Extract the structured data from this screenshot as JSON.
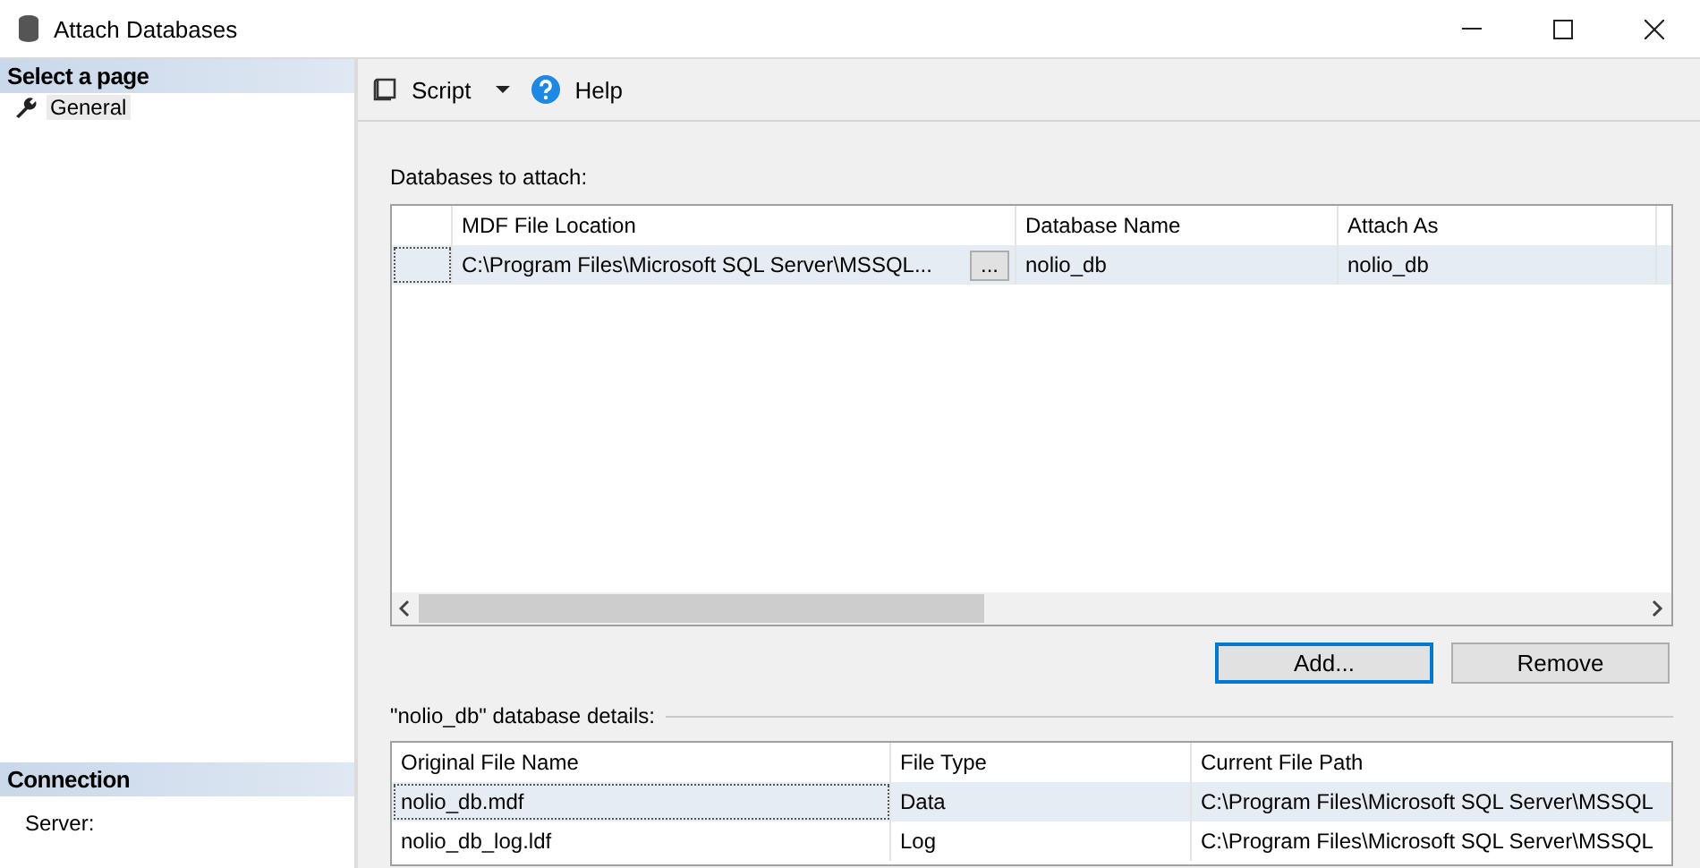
{
  "window": {
    "title": "Attach Databases"
  },
  "sidebar": {
    "header": "Select a page",
    "items": [
      {
        "label": "General",
        "selected": true
      }
    ],
    "connection_header": "Connection",
    "connection_items": [
      "Server:"
    ]
  },
  "toolbar": {
    "items": [
      {
        "label": "Script",
        "kind": "script"
      },
      {
        "label": "Help",
        "kind": "help"
      }
    ]
  },
  "attach": {
    "label": "Databases to attach:",
    "columns": [
      "MDF File Location",
      "Database Name",
      "Attach As"
    ],
    "rows": [
      {
        "cells": [
          "C:\\Program Files\\Microsoft SQL Server\\MSSQL...",
          "nolio_db",
          "nolio_db"
        ],
        "browse_button": "...",
        "selected": true
      }
    ]
  },
  "buttons": [
    {
      "label": "Add...",
      "focused": true
    },
    {
      "label": "Remove",
      "focused": false
    }
  ],
  "details": {
    "label": "\"nolio_db\" database details:",
    "columns": [
      "Original File Name",
      "File Type",
      "Current File Path"
    ],
    "rows": [
      {
        "cells": [
          "nolio_db.mdf",
          "Data",
          "C:\\Program Files\\Microsoft SQL Server\\MSSQL"
        ],
        "selected": true
      },
      {
        "cells": [
          "nolio_db_log.ldf",
          "Log",
          "C:\\Program Files\\Microsoft SQL Server\\MSSQL"
        ],
        "selected": false
      }
    ]
  }
}
